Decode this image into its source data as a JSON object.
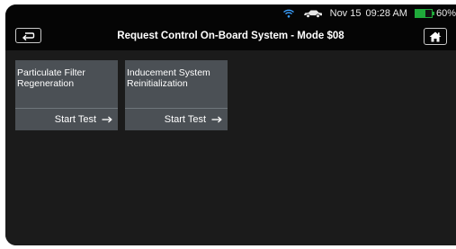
{
  "status": {
    "date": "Nov 15",
    "time": "09:28 AM",
    "battery_percent": "60%",
    "battery_level": 0.6,
    "colors": {
      "battery": "#1faa3a",
      "text": "#e8e8e8"
    }
  },
  "toolbar": {
    "title": "Request Control On-Board System - Mode $08",
    "back_icon": "back-arrow-icon",
    "home_icon": "home-icon"
  },
  "tests": [
    {
      "title": "Particulate Filter Regeneration",
      "action": "Start Test"
    },
    {
      "title": "Inducement System Reinitialization",
      "action": "Start Test"
    }
  ],
  "theme": {
    "background": "#141414",
    "tile": "#4b5055",
    "divider": "#6f767c"
  }
}
